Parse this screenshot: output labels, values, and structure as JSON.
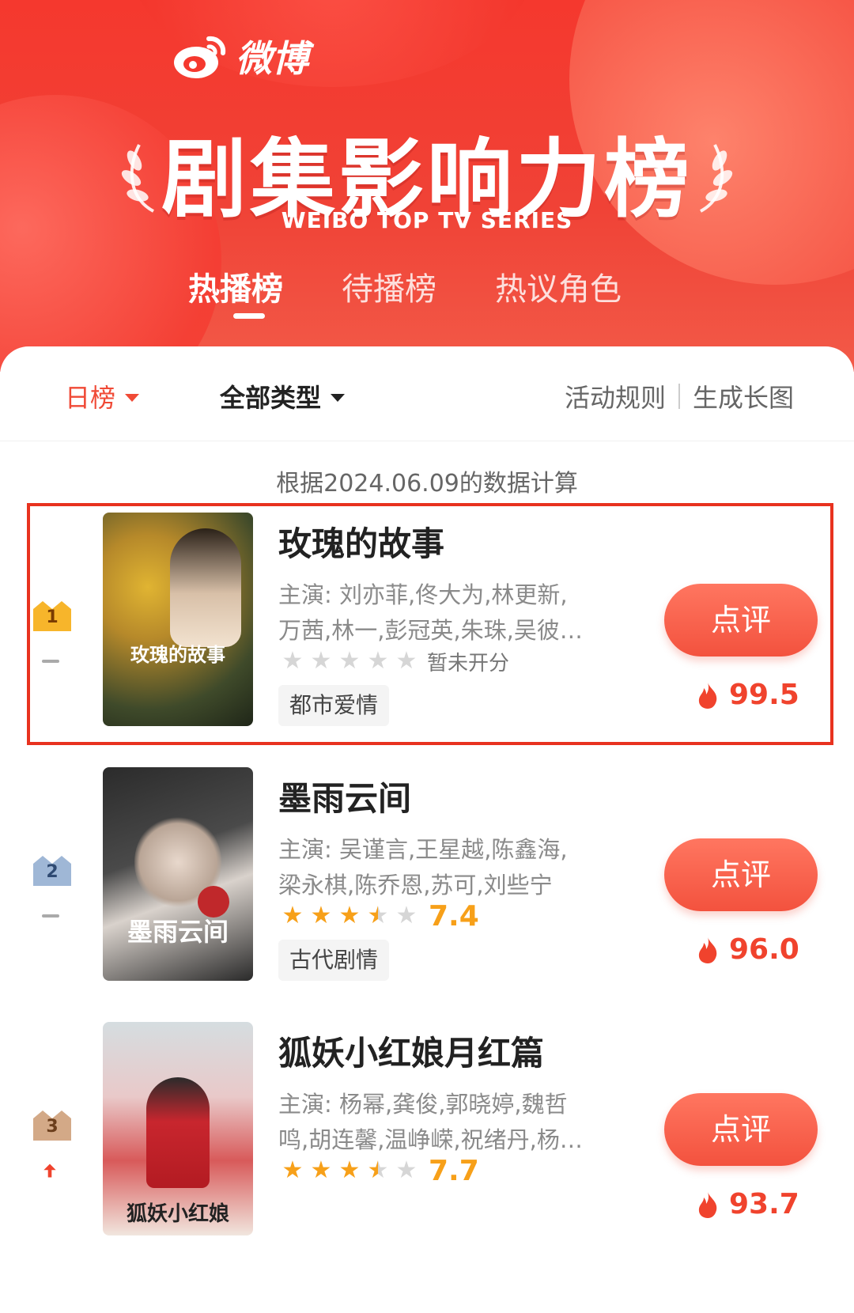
{
  "header": {
    "logo_text": "微博",
    "title": "剧集影响力榜",
    "subtitle": "WEIBO TOP TV SERIES",
    "tabs": [
      {
        "label": "热播榜",
        "active": true
      },
      {
        "label": "待播榜",
        "active": false
      },
      {
        "label": "热议角色",
        "active": false
      }
    ]
  },
  "filters": {
    "period": "日榜",
    "type": "全部类型",
    "rules_link": "活动规则",
    "long_image_link": "生成长图"
  },
  "data_note": "根据2024.06.09的数据计算",
  "colors": {
    "brand_red": "#f5382e",
    "accent_orange": "#f7a019",
    "highlight_border": "#e8321f"
  },
  "rows": [
    {
      "rank": "1",
      "trend": "flat",
      "title": "玫瑰的故事",
      "cast_line1": "主演: 刘亦菲,佟大为,林更新,",
      "cast_line2": "万茜,林一,彭冠英,朱珠,吴彼…",
      "stars": 0,
      "rating_text": "暂未开分",
      "genre": "都市爱情",
      "button": "点评",
      "heat": "99.5",
      "poster_caption": "玫瑰的故事",
      "highlighted": true
    },
    {
      "rank": "2",
      "trend": "flat",
      "title": "墨雨云间",
      "cast_line1": "主演: 吴谨言,王星越,陈鑫海,",
      "cast_line2": "梁永棋,陈乔恩,苏可,刘些宁",
      "stars": 3.5,
      "score": "7.4",
      "genre": "古代剧情",
      "button": "点评",
      "heat": "96.0",
      "poster_caption": "墨雨云间"
    },
    {
      "rank": "3",
      "trend": "up",
      "title": "狐妖小红娘月红篇",
      "cast_line1": "主演: 杨幂,龚俊,郭晓婷,魏哲",
      "cast_line2": "鸣,胡连馨,温峥嵘,祝绪丹,杨…",
      "stars": 3.5,
      "score": "7.7",
      "button": "点评",
      "heat": "93.7",
      "poster_caption": "狐妖小红娘"
    }
  ]
}
